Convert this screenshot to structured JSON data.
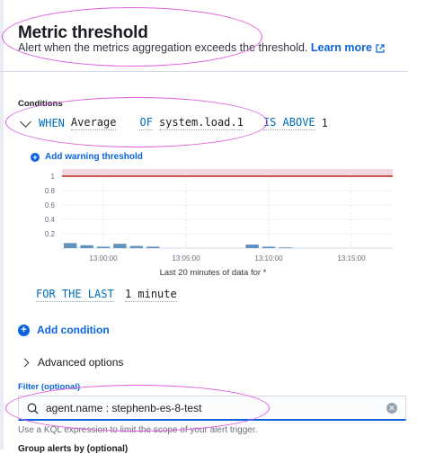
{
  "header": {
    "title": "Metric threshold",
    "subtitle": "Alert when the metrics aggregation exceeds the threshold.",
    "learn_more": "Learn more"
  },
  "conditions": {
    "label": "Conditions",
    "when_kw": "WHEN",
    "aggregation": "Average",
    "of_kw": "OF",
    "metric": "system.load.1",
    "comparator_kw": "IS ABOVE",
    "threshold": "1",
    "add_warning": "Add warning threshold"
  },
  "chart_data": {
    "type": "bar",
    "x_ticks": [
      "13:00:00",
      "13:05:00",
      "13:10:00",
      "13:15:00"
    ],
    "y_ticks": [
      "1",
      "0.8",
      "0.6",
      "0.4",
      "0.2"
    ],
    "ylim": [
      0,
      1.1
    ],
    "threshold": 1,
    "caption": "Last 20 minutes of data for *",
    "bar_color": "#6092c0",
    "threshold_color": "#bd271e",
    "series": [
      {
        "values": [
          0.07,
          0.04,
          0.02,
          0.06,
          0.03,
          0.02,
          0.0,
          0.0,
          0.0,
          0.0,
          0.0,
          0.05,
          0.02,
          0.01,
          0.0,
          0.0,
          0.0,
          0.0,
          0.0,
          0.0
        ]
      }
    ]
  },
  "for_last": {
    "kw": "FOR THE LAST",
    "value": "1 minute"
  },
  "add_condition": "Add condition",
  "advanced_options": "Advanced options",
  "filter": {
    "label": "Filter (optional)",
    "value": "agent.name : stephenb-es-8-test",
    "help": "Use a KQL expression to limit the scope of your alert trigger."
  },
  "next_section_partial": "Group alerts by (optional)"
}
